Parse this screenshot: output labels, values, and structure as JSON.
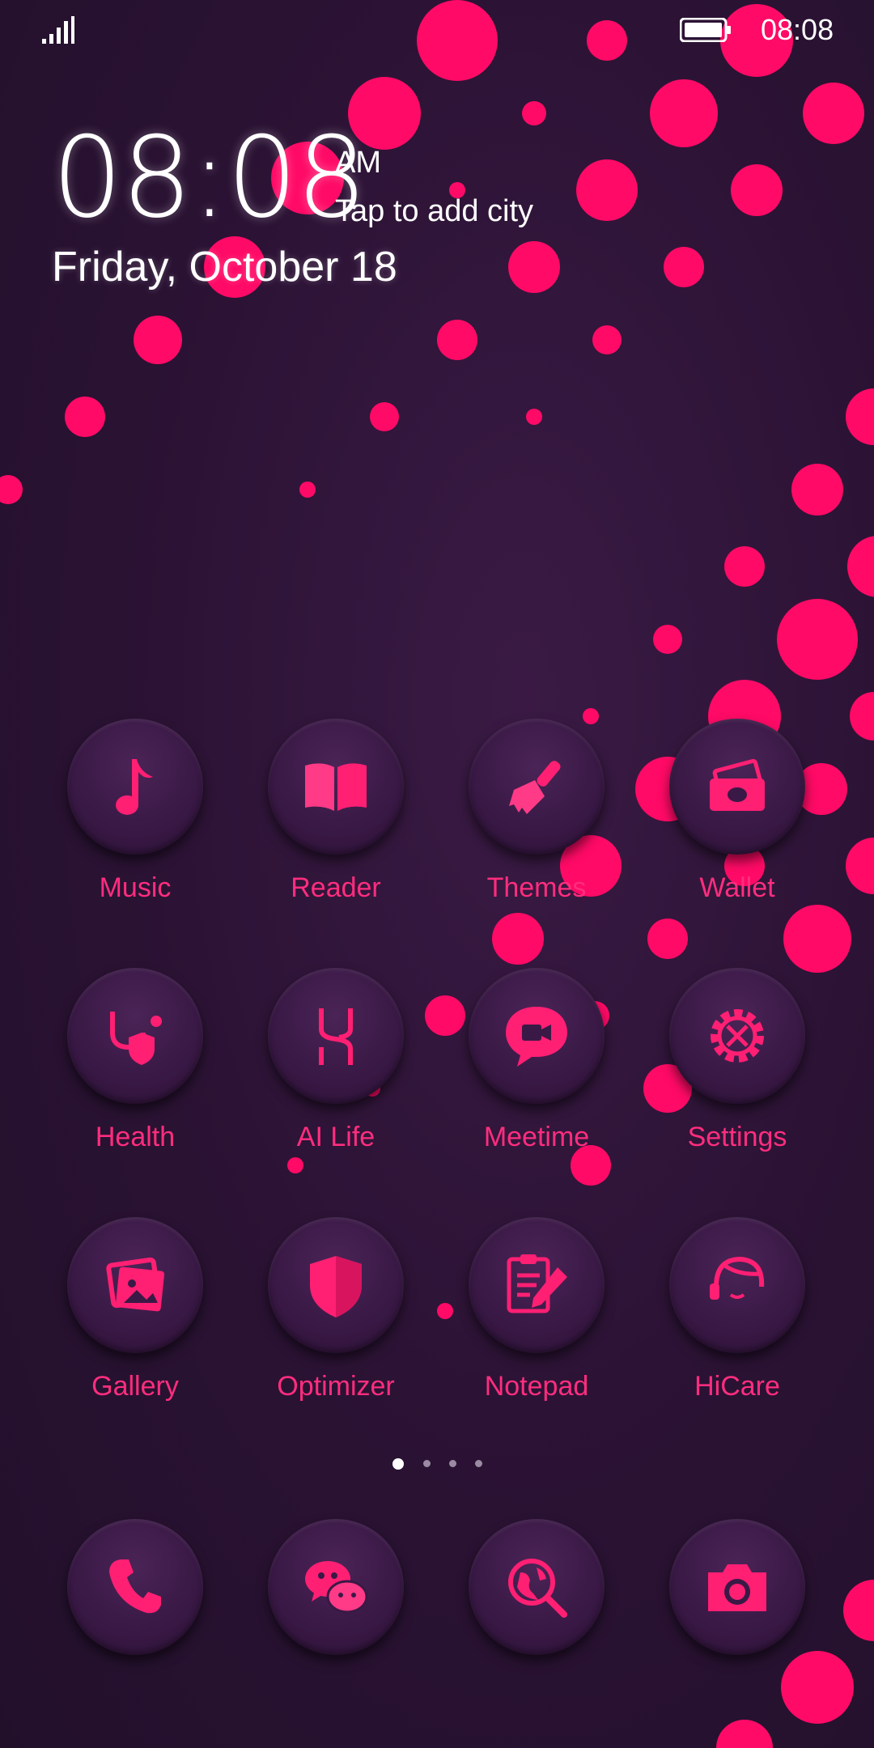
{
  "status_bar": {
    "time": "08:08",
    "signal_icon": "signal-icon",
    "battery_icon": "battery-icon"
  },
  "clock_widget": {
    "time": "08:08",
    "ampm": "AM",
    "city_prompt": "Tap to add city",
    "date": "Friday, October 18"
  },
  "apps": [
    {
      "label": "Music",
      "icon": "music-note-icon"
    },
    {
      "label": "Reader",
      "icon": "book-icon"
    },
    {
      "label": "Themes",
      "icon": "paintbrush-icon"
    },
    {
      "label": "Wallet",
      "icon": "wallet-icon"
    },
    {
      "label": "Health",
      "icon": "stethoscope-icon"
    },
    {
      "label": "AI Life",
      "icon": "ai-life-icon"
    },
    {
      "label": "Meetime",
      "icon": "video-chat-icon"
    },
    {
      "label": "Settings",
      "icon": "gear-icon"
    },
    {
      "label": "Gallery",
      "icon": "gallery-icon"
    },
    {
      "label": "Optimizer",
      "icon": "shield-icon"
    },
    {
      "label": "Notepad",
      "icon": "notepad-icon"
    },
    {
      "label": "HiCare",
      "icon": "headset-icon"
    }
  ],
  "pager": {
    "count": 4,
    "active": 0
  },
  "dock": [
    {
      "icon": "phone-icon"
    },
    {
      "icon": "chat-icon"
    },
    {
      "icon": "browser-icon"
    },
    {
      "icon": "camera-icon"
    }
  ],
  "colors": {
    "accent": "#ff1f73",
    "dot": "#ff0a66",
    "background": "#2a1233"
  }
}
